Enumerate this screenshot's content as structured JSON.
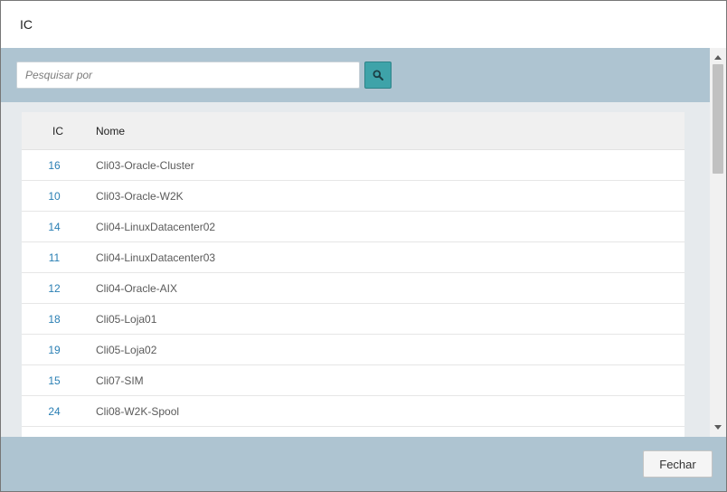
{
  "modal": {
    "title": "IC"
  },
  "search": {
    "placeholder": "Pesquisar por",
    "value": "",
    "button_icon": "search-icon"
  },
  "table": {
    "columns": [
      "IC",
      "Nome"
    ],
    "rows": [
      {
        "ic": "16",
        "nome": "Cli03-Oracle-Cluster"
      },
      {
        "ic": "10",
        "nome": "Cli03-Oracle-W2K"
      },
      {
        "ic": "14",
        "nome": "Cli04-LinuxDatacenter02"
      },
      {
        "ic": "11",
        "nome": "Cli04-LinuxDatacenter03"
      },
      {
        "ic": "12",
        "nome": "Cli04-Oracle-AIX"
      },
      {
        "ic": "18",
        "nome": "Cli05-Loja01"
      },
      {
        "ic": "19",
        "nome": "Cli05-Loja02"
      },
      {
        "ic": "15",
        "nome": "Cli07-SIM"
      },
      {
        "ic": "24",
        "nome": "Cli08-W2K-Spool"
      },
      {
        "ic": "",
        "nome": ""
      }
    ]
  },
  "footer": {
    "close_label": "Fechar"
  },
  "colors": {
    "header_band": "#aec4d1",
    "search_button": "#3ea3a9",
    "link": "#2a7fb4"
  }
}
